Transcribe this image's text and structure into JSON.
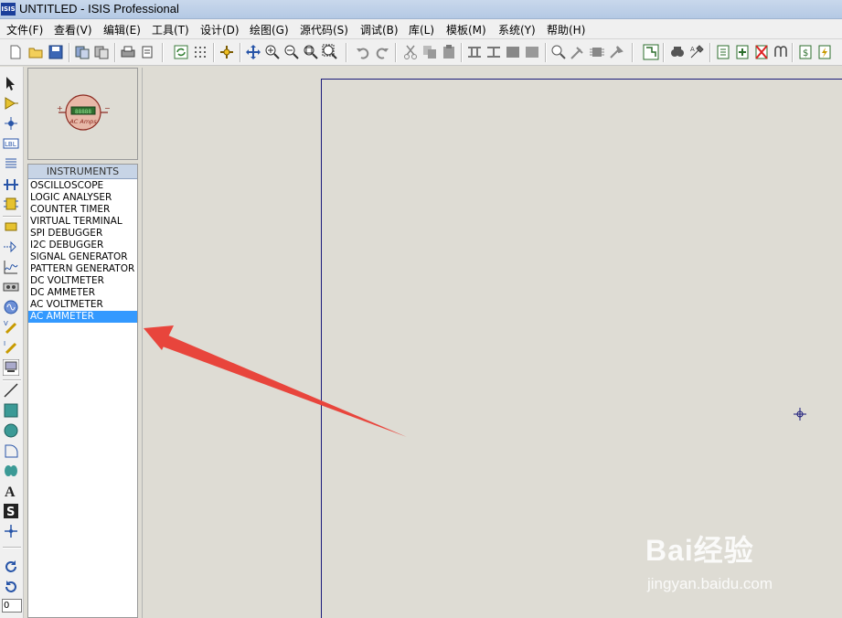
{
  "window": {
    "logo": "ISIS",
    "title": "UNTITLED - ISIS Professional"
  },
  "menu": [
    "文件(F)",
    "查看(V)",
    "编辑(E)",
    "工具(T)",
    "设计(D)",
    "绘图(G)",
    "源代码(S)",
    "调试(B)",
    "库(L)",
    "模板(M)",
    "系统(Y)",
    "帮助(H)"
  ],
  "preview": {
    "device_label": "AC Amps",
    "display": "88888"
  },
  "device_panel": {
    "header": "INSTRUMENTS",
    "items": [
      "OSCILLOSCOPE",
      "LOGIC ANALYSER",
      "COUNTER TIMER",
      "VIRTUAL TERMINAL",
      "SPI DEBUGGER",
      "I2C DEBUGGER",
      "SIGNAL GENERATOR",
      "PATTERN GENERATOR",
      "DC VOLTMETER",
      "DC AMMETER",
      "AC VOLTMETER",
      "AC AMMETER"
    ],
    "selected": "AC AMMETER"
  },
  "rotation_value": "0",
  "watermark": {
    "logo": "Bai经验",
    "url": "jingyan.baidu.com"
  },
  "colors": {
    "selection": "#3399ff",
    "annotation_arrow": "#e8453c",
    "sheet_border": "#1a1a7a"
  }
}
